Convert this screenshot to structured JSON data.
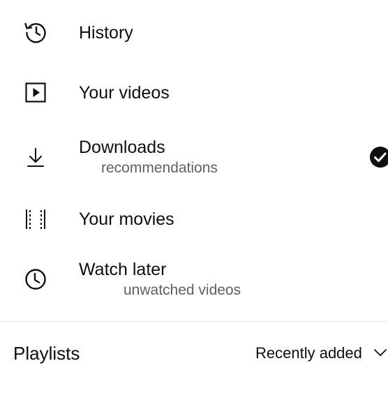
{
  "menu": {
    "items": [
      {
        "label": "History",
        "icon": "history-icon"
      },
      {
        "label": "Your videos",
        "icon": "play-box-icon"
      },
      {
        "label": "Downloads",
        "sublabel": "recommendations",
        "icon": "download-icon",
        "status_icon": "check-circle-icon"
      },
      {
        "label": "Your movies",
        "icon": "film-strip-icon"
      },
      {
        "label": "Watch later",
        "sublabel": "unwatched videos",
        "icon": "clock-icon"
      }
    ]
  },
  "playlists": {
    "title": "Playlists",
    "sort": {
      "selected": "Recently added",
      "icon": "chevron-down-icon"
    }
  }
}
